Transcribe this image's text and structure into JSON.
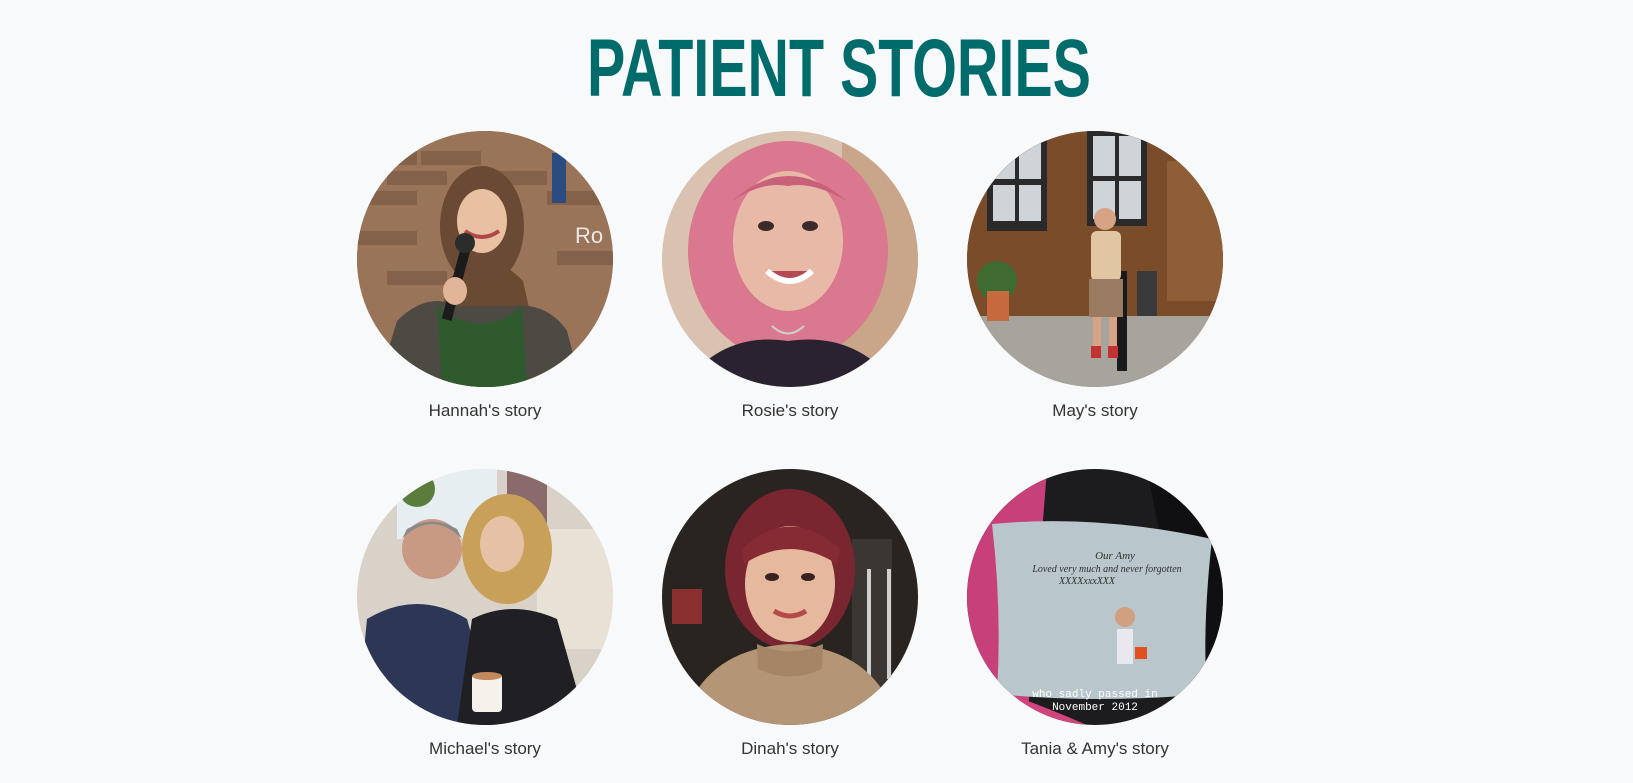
{
  "page": {
    "title": "PATIENT STORIES",
    "accent_color": "#006b6b",
    "background_color": "#f8f9fa"
  },
  "stories": [
    {
      "label": "Hannah's story",
      "photo": "woman-speaking-into-microphone-photo"
    },
    {
      "label": "Rosie's story",
      "photo": "pink-haired-woman-selfie-photo"
    },
    {
      "label": "May's story",
      "photo": "person-standing-by-building-photo"
    },
    {
      "label": "Michael's story",
      "photo": "father-and-daughter-on-sofa-photo"
    },
    {
      "label": "Dinah's story",
      "photo": "red-haired-woman-portrait-photo"
    },
    {
      "label": "Tania & Amy's story",
      "photo": "memorial-cushion-photo",
      "cushion_text": {
        "line1": "Our Amy",
        "line2": "Loved very much and never forgotten",
        "line3": "XXXXxxxXXX",
        "caption_line1": "who sadly passed in",
        "caption_line2": "November 2012"
      }
    }
  ]
}
